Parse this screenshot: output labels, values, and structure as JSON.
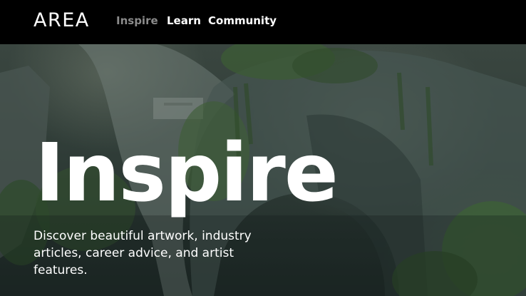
{
  "brand": {
    "logo_text": "AREA"
  },
  "nav": {
    "items": [
      {
        "label": "Inspire",
        "active": true
      },
      {
        "label": "Learn",
        "active": false
      },
      {
        "label": "Community",
        "active": false
      }
    ]
  },
  "hero": {
    "title": "Inspire",
    "description": "Discover beautiful artwork, industry articles, career advice, and artist features."
  },
  "colors": {
    "nav_background": "#000000",
    "active_nav": "#8b8b8b",
    "text": "#ffffff"
  }
}
